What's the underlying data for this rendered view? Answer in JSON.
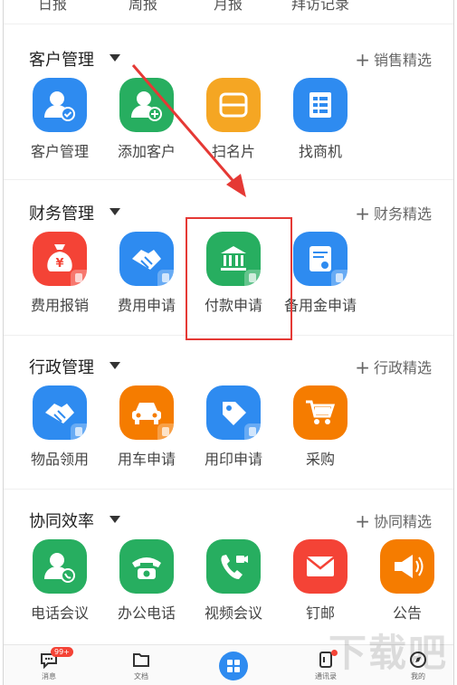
{
  "top_strip": [
    "日报",
    "周报",
    "月报",
    "拜访记录"
  ],
  "sections": [
    {
      "title": "客户管理",
      "more": "销售精选",
      "items": [
        {
          "label": "客户管理",
          "icon": "user-check-icon",
          "color": "#2e8bf0"
        },
        {
          "label": "添加客户",
          "icon": "user-add-icon",
          "color": "#27ae60"
        },
        {
          "label": "扫名片",
          "icon": "scan-card-icon",
          "color": "#f5a623"
        },
        {
          "label": "找商机",
          "icon": "document-icon",
          "color": "#2e8bf0"
        }
      ]
    },
    {
      "title": "财务管理",
      "more": "财务精选",
      "items": [
        {
          "label": "费用报销",
          "icon": "money-bag-icon",
          "color": "#f44336"
        },
        {
          "label": "费用申请",
          "icon": "handshake-icon",
          "color": "#2e8bf0"
        },
        {
          "label": "付款申请",
          "icon": "bank-icon",
          "color": "#27ae60"
        },
        {
          "label": "备用金申请",
          "icon": "certificate-icon",
          "color": "#2e8bf0"
        }
      ]
    },
    {
      "title": "行政管理",
      "more": "行政精选",
      "items": [
        {
          "label": "物品领用",
          "icon": "handshake-icon",
          "color": "#2e8bf0"
        },
        {
          "label": "用车申请",
          "icon": "car-icon",
          "color": "#f57c00"
        },
        {
          "label": "用印申请",
          "icon": "tag-icon",
          "color": "#2e8bf0"
        },
        {
          "label": "采购",
          "icon": "cart-icon",
          "color": "#f57c00"
        }
      ]
    },
    {
      "title": "协同效率",
      "more": "协同精选",
      "items": [
        {
          "label": "电话会议",
          "icon": "conference-call-icon",
          "color": "#27ae60"
        },
        {
          "label": "办公电话",
          "icon": "telephone-icon",
          "color": "#27ae60"
        },
        {
          "label": "视频会议",
          "icon": "video-call-icon",
          "color": "#27ae60"
        },
        {
          "label": "钉邮",
          "icon": "mail-icon",
          "color": "#f44336"
        },
        {
          "label": "公告",
          "icon": "megaphone-icon",
          "color": "#f57c00"
        }
      ]
    }
  ],
  "tabbar": {
    "items": [
      {
        "label": "消息",
        "icon": "chat-icon"
      },
      {
        "label": "文档",
        "icon": "folder-icon"
      },
      {
        "label": "",
        "icon": "workbench-icon"
      },
      {
        "label": "通讯录",
        "icon": "contacts-icon"
      },
      {
        "label": "我的",
        "icon": "compass-icon"
      }
    ],
    "message_badge": "99+"
  },
  "watermark": "下载吧",
  "colors": {
    "accent_blue": "#2e8bf0",
    "highlight_red": "#e53935"
  }
}
